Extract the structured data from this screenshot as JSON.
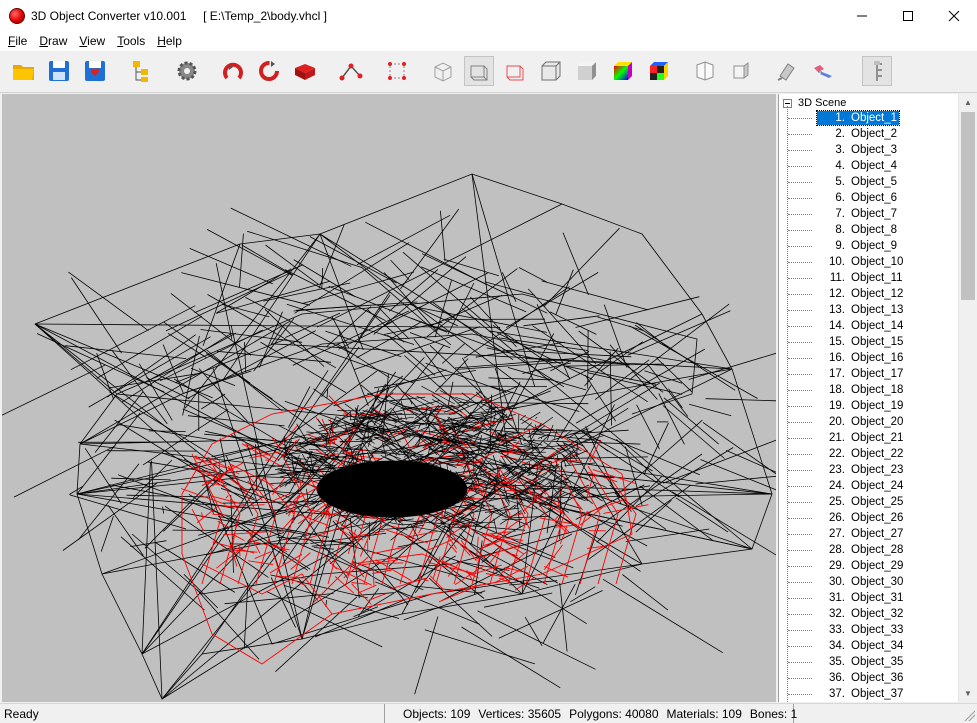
{
  "window": {
    "title": "3D Object Converter v10.001     [ E:\\Temp_2\\body.vhcl ]"
  },
  "menu": [
    {
      "first": "F",
      "rest": "ile"
    },
    {
      "first": "D",
      "rest": "raw"
    },
    {
      "first": "V",
      "rest": "iew"
    },
    {
      "first": "T",
      "rest": "ools"
    },
    {
      "first": "H",
      "rest": "elp"
    }
  ],
  "toolbar": {
    "icons": [
      "open-folder-icon",
      "save-icon",
      "save-as-icon",
      "hierarchy-icon",
      "settings-gear-icon",
      "rotate-x-icon",
      "rotate-y-icon",
      "move-object-icon",
      "vertices-icon",
      "bounding-points-icon",
      "wire-box-icon",
      "wire-box-gray-icon",
      "wire-box-red-icon",
      "solid-box-icon",
      "shaded-box-icon",
      "color-gradient-box-icon",
      "textured-box-icon",
      "box-front-icon",
      "box-side-icon",
      "light-icon",
      "camera-icon",
      "bone-chain-icon"
    ]
  },
  "colors": {
    "viewport_bg": "#c0c0c0",
    "wire_black": "#000000",
    "wire_red": "#ff0000",
    "selection": "#0078d7"
  },
  "tree": {
    "root_label": "3D Scene",
    "items": [
      {
        "num": "1.",
        "name": "Object_1"
      },
      {
        "num": "2.",
        "name": "Object_2"
      },
      {
        "num": "3.",
        "name": "Object_3"
      },
      {
        "num": "4.",
        "name": "Object_4"
      },
      {
        "num": "5.",
        "name": "Object_5"
      },
      {
        "num": "6.",
        "name": "Object_6"
      },
      {
        "num": "7.",
        "name": "Object_7"
      },
      {
        "num": "8.",
        "name": "Object_8"
      },
      {
        "num": "9.",
        "name": "Object_9"
      },
      {
        "num": "10.",
        "name": "Object_10"
      },
      {
        "num": "11.",
        "name": "Object_11"
      },
      {
        "num": "12.",
        "name": "Object_12"
      },
      {
        "num": "13.",
        "name": "Object_13"
      },
      {
        "num": "14.",
        "name": "Object_14"
      },
      {
        "num": "15.",
        "name": "Object_15"
      },
      {
        "num": "16.",
        "name": "Object_16"
      },
      {
        "num": "17.",
        "name": "Object_17"
      },
      {
        "num": "18.",
        "name": "Object_18"
      },
      {
        "num": "19.",
        "name": "Object_19"
      },
      {
        "num": "20.",
        "name": "Object_20"
      },
      {
        "num": "21.",
        "name": "Object_21"
      },
      {
        "num": "22.",
        "name": "Object_22"
      },
      {
        "num": "23.",
        "name": "Object_23"
      },
      {
        "num": "24.",
        "name": "Object_24"
      },
      {
        "num": "25.",
        "name": "Object_25"
      },
      {
        "num": "26.",
        "name": "Object_26"
      },
      {
        "num": "27.",
        "name": "Object_27"
      },
      {
        "num": "28.",
        "name": "Object_28"
      },
      {
        "num": "29.",
        "name": "Object_29"
      },
      {
        "num": "30.",
        "name": "Object_30"
      },
      {
        "num": "31.",
        "name": "Object_31"
      },
      {
        "num": "32.",
        "name": "Object_32"
      },
      {
        "num": "33.",
        "name": "Object_33"
      },
      {
        "num": "34.",
        "name": "Object_34"
      },
      {
        "num": "35.",
        "name": "Object_35"
      },
      {
        "num": "36.",
        "name": "Object_36"
      },
      {
        "num": "37.",
        "name": "Object_37"
      }
    ],
    "selected_index": 0
  },
  "status": {
    "left": "Ready",
    "objects": "Objects: 109",
    "vertices": "Vertices: 35605",
    "polygons": "Polygons: 40080",
    "materials": "Materials: 109",
    "bones": "Bones: 1"
  }
}
